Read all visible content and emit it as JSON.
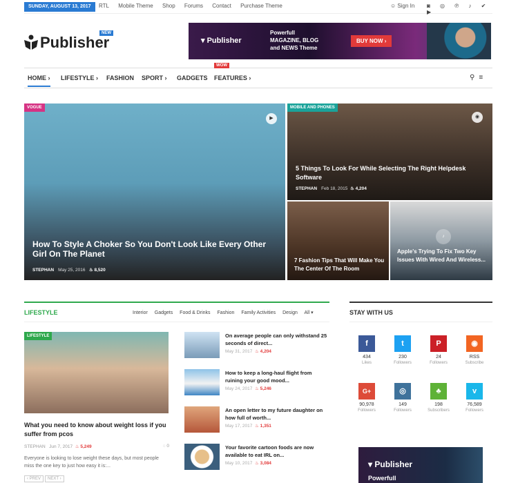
{
  "topbar": {
    "date": "SUNDAY, AUGUST 13, 2017",
    "links": [
      "RTL",
      "Mobile Theme",
      "Shop",
      "Forums",
      "Contact",
      "Purchase Theme"
    ],
    "signin": "Sign In",
    "social_glyphs": "◙ ◎ ℗ ♪ ✔ ▶"
  },
  "brand": {
    "name": "Publisher",
    "badge": "NEW"
  },
  "banner": {
    "logo": "Publisher",
    "line1": "Powerfull",
    "line2": "MAGAZINE, BLOG",
    "line3": "and NEWS Theme",
    "cta": "BUY NOW ›"
  },
  "nav": {
    "items": [
      "HOME",
      "LIFESTYLE",
      "FASHION",
      "SPORT",
      "GADGETS",
      "FEATURES"
    ],
    "wow_badge": "WOW"
  },
  "hero": [
    {
      "category": "VOGUE",
      "title": "How To Style A Choker So You Don't Look Like Every Other Girl On The Planet",
      "author": "STEPHAN",
      "date": "May 25, 2016",
      "views": "8,520"
    },
    {
      "category": "MOBILE AND PHONES",
      "title": "5 Things To Look For While Selecting The Right Helpdesk Software",
      "author": "STEPHAN",
      "date": "Feb 18, 2015",
      "views": "4,204"
    },
    {
      "title": "7 Fashion Tips That Will Make You The Center Of The Room"
    },
    {
      "title": "Apple's Trying To Fix Two Key Issues With Wired And Wireless..."
    }
  ],
  "lifestyle": {
    "title": "LIFESTYLE",
    "tabs": [
      "Interior",
      "Gadgets",
      "Food & Drinks",
      "Fashion",
      "Family Activities",
      "Design",
      "All ▾"
    ],
    "featured": {
      "category": "LIFESTYLE",
      "title": "What you need to know about weight loss if you suffer from pcos",
      "author": "STEPHAN",
      "date": "Jun 7, 2017",
      "views": "5,249",
      "comments": "0",
      "excerpt": "Everyone is looking to lose weight these days, but most people miss the one key to just how easy it is:..."
    },
    "items": [
      {
        "title": "On average people can only withstand 25 seconds of direct...",
        "date": "May 31, 2017",
        "views": "4,204"
      },
      {
        "title": "How to keep a long-haul flight from ruining your good mood...",
        "date": "May 24, 2017",
        "views": "5,246"
      },
      {
        "title": "An open letter to my future daughter on how full of worth...",
        "date": "May 17, 2017",
        "views": "1,351"
      },
      {
        "title": "Your favorite cartoon foods are now available to eat IRL on...",
        "date": "May 10, 2017",
        "views": "3,084"
      }
    ],
    "pager": {
      "prev": "‹ PREV",
      "next": "NEXT ›"
    }
  },
  "stay": {
    "title": "STAY WITH US",
    "networks": [
      {
        "glyph": "f",
        "count": "434",
        "label": "Likes",
        "color": "#3b5998"
      },
      {
        "glyph": "t",
        "count": "230",
        "label": "Followers",
        "color": "#1da1f2"
      },
      {
        "glyph": "P",
        "count": "24",
        "label": "Followers",
        "color": "#cb2027"
      },
      {
        "glyph": "◉",
        "count": "RSS",
        "label": "Subscribe",
        "color": "#f26522"
      },
      {
        "glyph": "G+",
        "count": "90,978",
        "label": "Followers",
        "color": "#dd4b39"
      },
      {
        "glyph": "◎",
        "count": "149",
        "label": "Followers",
        "color": "#3f729b"
      },
      {
        "glyph": "♣",
        "count": "198",
        "label": "Subscribers",
        "color": "#5eb237"
      },
      {
        "glyph": "v",
        "count": "76,589",
        "label": "Followers",
        "color": "#1ab7ea"
      }
    ]
  },
  "side_ad": {
    "logo": "Publisher",
    "text": "Powerfull"
  },
  "colors": {
    "accent": "#2a7bd3",
    "green": "#2ea84c",
    "red": "#e23a3a"
  }
}
